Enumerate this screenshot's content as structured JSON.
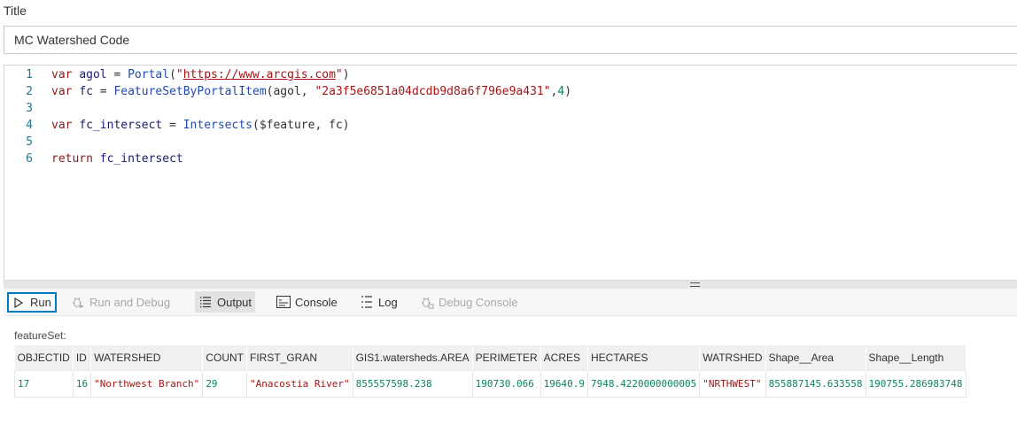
{
  "title_field": {
    "label": "Title",
    "value": "MC Watershed Code"
  },
  "editor": {
    "lines": [
      {
        "num": "1",
        "tokens": [
          {
            "t": "var ",
            "c": "kw"
          },
          {
            "t": "agol",
            "c": "id"
          },
          {
            "t": " = ",
            "c": "plain"
          },
          {
            "t": "Portal",
            "c": "fn"
          },
          {
            "t": "(",
            "c": "plain"
          },
          {
            "t": "\"",
            "c": "str"
          },
          {
            "t": "https://www.arcgis.com",
            "c": "url"
          },
          {
            "t": "\"",
            "c": "str"
          },
          {
            "t": ")",
            "c": "plain"
          }
        ]
      },
      {
        "num": "2",
        "tokens": [
          {
            "t": "var ",
            "c": "kw"
          },
          {
            "t": "fc",
            "c": "id"
          },
          {
            "t": " = ",
            "c": "plain"
          },
          {
            "t": "FeatureSetByPortalItem",
            "c": "fn"
          },
          {
            "t": "(agol, ",
            "c": "plain"
          },
          {
            "t": "\"2a3f5e6851a04dcdb9d8a6f796e9a431\"",
            "c": "str"
          },
          {
            "t": ",",
            "c": "plain"
          },
          {
            "t": "4",
            "c": "num"
          },
          {
            "t": ")",
            "c": "plain"
          }
        ]
      },
      {
        "num": "3",
        "tokens": []
      },
      {
        "num": "4",
        "tokens": [
          {
            "t": "var ",
            "c": "kw"
          },
          {
            "t": "fc_intersect",
            "c": "id"
          },
          {
            "t": " = ",
            "c": "plain"
          },
          {
            "t": "Intersects",
            "c": "fn"
          },
          {
            "t": "($feature, fc)",
            "c": "plain"
          }
        ]
      },
      {
        "num": "5",
        "tokens": []
      },
      {
        "num": "6",
        "tokens": [
          {
            "t": "return ",
            "c": "kw"
          },
          {
            "t": "fc_intersect",
            "c": "id"
          }
        ]
      }
    ]
  },
  "toolbar": {
    "run": "Run",
    "run_debug": "Run and Debug",
    "output": "Output",
    "console": "Console",
    "log": "Log",
    "debug_console": "Debug Console"
  },
  "results": {
    "label": "featureSet:",
    "columns": [
      "OBJECTID",
      "ID",
      "WATERSHED",
      "COUNT",
      "FIRST_GRAN",
      "GIS1.watersheds.AREA",
      "PERIMETER",
      "ACRES",
      "HECTARES",
      "WATRSHED",
      "Shape__Area",
      "Shape__Length"
    ],
    "rows": [
      [
        {
          "v": "17",
          "k": "n"
        },
        {
          "v": "16",
          "k": "n"
        },
        {
          "v": "\"Northwest Branch\"",
          "k": "s"
        },
        {
          "v": "29",
          "k": "n"
        },
        {
          "v": "\"Anacostia River\"",
          "k": "s"
        },
        {
          "v": "855557598.238",
          "k": "n"
        },
        {
          "v": "190730.066",
          "k": "n"
        },
        {
          "v": "19640.9",
          "k": "n"
        },
        {
          "v": "7948.4220000000005",
          "k": "n"
        },
        {
          "v": "\"NRTHWEST\"",
          "k": "s"
        },
        {
          "v": "855887145.633558",
          "k": "n"
        },
        {
          "v": "190755.286983748",
          "k": "n"
        }
      ]
    ]
  }
}
